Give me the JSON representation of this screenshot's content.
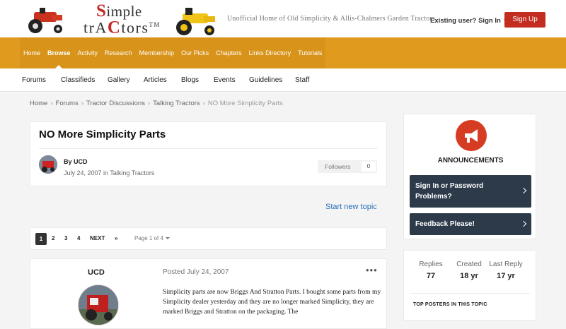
{
  "header": {
    "logo_line1_a": "S",
    "logo_line1_b": "imple",
    "logo_line2_a": "trA",
    "logo_line2_b": "C",
    "logo_line2_c": "tors",
    "logo_tm": "TM",
    "tagline": "Unofficial Home of Old Simplicity & Allis-Chalmers Garden Tractors",
    "signin_label": "Existing user? Sign In",
    "signup_label": "Sign Up"
  },
  "main_nav": [
    {
      "label": "Home"
    },
    {
      "label": "Browse"
    },
    {
      "label": "Activity"
    },
    {
      "label": "Research"
    },
    {
      "label": "Membership"
    },
    {
      "label": "Our Picks"
    },
    {
      "label": "Chapters"
    },
    {
      "label": "Links Directory"
    },
    {
      "label": "Tutorials"
    }
  ],
  "sub_nav": [
    {
      "label": "Forums"
    },
    {
      "label": "Classifieds"
    },
    {
      "label": "Gallery"
    },
    {
      "label": "Articles"
    },
    {
      "label": "Blogs"
    },
    {
      "label": "Events"
    },
    {
      "label": "Guidelines"
    },
    {
      "label": "Staff"
    }
  ],
  "breadcrumb": [
    {
      "label": "Home"
    },
    {
      "label": "Forums"
    },
    {
      "label": "Tractor Discussions"
    },
    {
      "label": "Talking Tractors"
    },
    {
      "label": "NO More Simplicity Parts"
    }
  ],
  "topic": {
    "title": "NO More Simplicity Parts",
    "byline": "By UCD",
    "date": "July 24, 2007 in Talking Tractors",
    "followers_label": "Followers",
    "followers_count": "0"
  },
  "start_new_topic": "Start new topic",
  "pagination": {
    "pages": [
      "1",
      "2",
      "3",
      "4"
    ],
    "next_label": "NEXT",
    "last_label": "»",
    "page_of": "Page 1 of 4"
  },
  "post": {
    "author": "UCD",
    "date": "Posted July 24, 2007",
    "menu": "•••",
    "body": "Simplicity parts are now Briggs And Stratton Parts. I bought some parts from my Simplicity dealer yesterday and they are no longer marked Simplicity, they are marked Briggs and Stratton on the packaging. The"
  },
  "sidebar": {
    "announcements_title": "ANNOUNCEMENTS",
    "announcements": [
      {
        "label": "Sign In or Password Problems?"
      },
      {
        "label": "Feedback Please!"
      }
    ],
    "stats": [
      {
        "label": "Replies",
        "value": "77"
      },
      {
        "label": "Created",
        "value": "18 yr"
      },
      {
        "label": "Last Reply",
        "value": "17 yr"
      }
    ],
    "top_posters": "TOP POSTERS IN THIS TOPIC"
  },
  "colors": {
    "nav_bar": "#e09b1f",
    "signup": "#c22d1f",
    "announcement_item": "#2c3a4a",
    "link": "#2a70b8",
    "megaphone": "#d63c22"
  }
}
